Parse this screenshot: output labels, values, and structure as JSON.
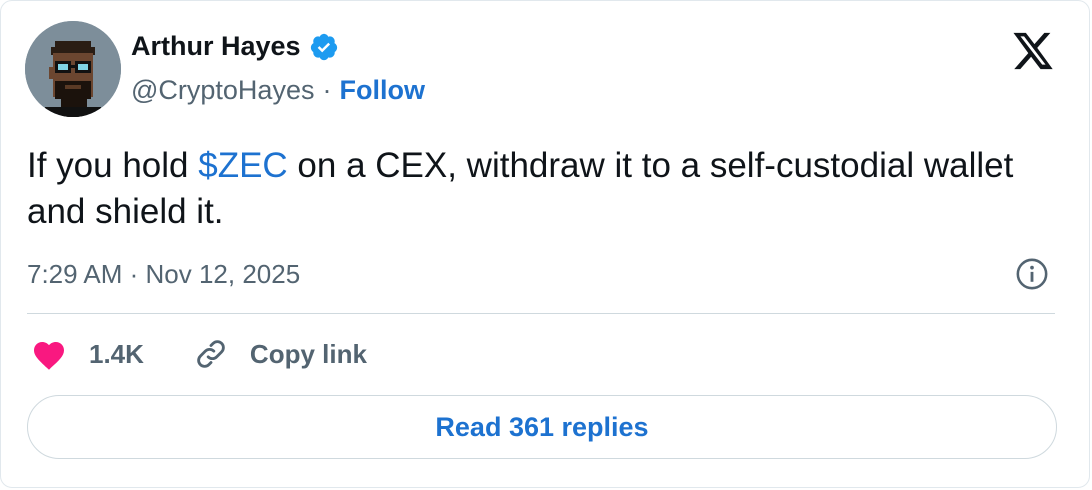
{
  "tweet": {
    "author": {
      "name": "Arthur Hayes",
      "handle": "@CryptoHayes",
      "separator": "·",
      "follow_label": "Follow",
      "verified_icon": "verified-badge-icon",
      "avatar_icon": "pixel-punk-avatar"
    },
    "text_before": "If you hold ",
    "cashtag": "$ZEC",
    "text_after": " on a CEX, withdraw it to a self-custodial wallet and shield it.",
    "timestamp": "7:29 AM · Nov 12, 2025",
    "likes": "1.4K",
    "copy_link_label": "Copy link",
    "replies_label": "Read 361 replies"
  },
  "colors": {
    "accent": "#1d72d0",
    "heart": "#f91880",
    "muted": "#536471",
    "text": "#0f1419"
  }
}
